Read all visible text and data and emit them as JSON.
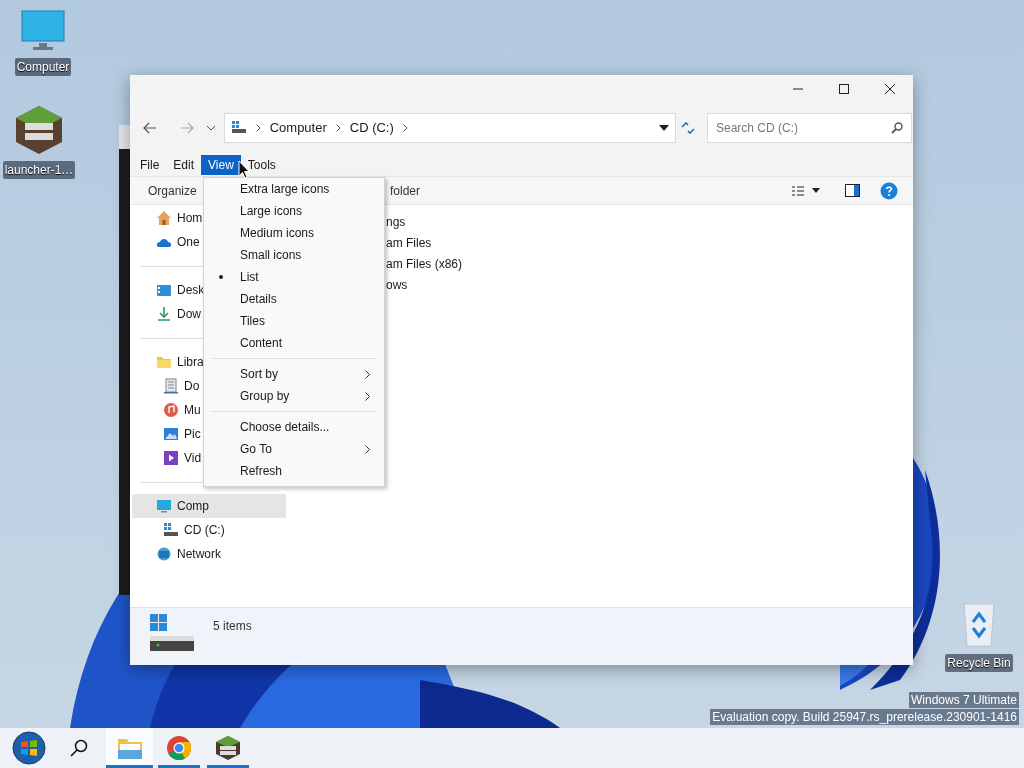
{
  "desktop_icons": [
    {
      "kind": "computer",
      "label": "Computer"
    },
    {
      "kind": "game",
      "label": "launcher-1…"
    },
    {
      "kind": "recycle",
      "label": "Recycle Bin"
    }
  ],
  "window": {
    "address_bar": {
      "path": [
        "Computer",
        "CD (C:)"
      ]
    },
    "search": {
      "placeholder": "Search CD (C:)"
    },
    "menu_bar": [
      {
        "label": "File",
        "selected": false
      },
      {
        "label": "Edit",
        "selected": false
      },
      {
        "label": "View",
        "selected": true
      },
      {
        "label": "Tools",
        "selected": false
      }
    ],
    "command_bar": {
      "organize": "Organize",
      "new_folder": "folder"
    },
    "nav_pane": [
      {
        "items": [
          {
            "kind": "home",
            "label": "Hom",
            "selected": false
          },
          {
            "kind": "cloud",
            "label": "One",
            "selected": false
          }
        ]
      },
      {
        "items": [
          {
            "kind": "desktop",
            "label": "Desk",
            "selected": false
          },
          {
            "kind": "download",
            "label": "Dow",
            "selected": false
          }
        ]
      },
      {
        "items": [
          {
            "kind": "folder",
            "label": "Libra",
            "selected": false,
            "children": [
              {
                "kind": "document",
                "label": "Do",
                "selected": false
              },
              {
                "kind": "music",
                "label": "Mu",
                "selected": false
              },
              {
                "kind": "picture",
                "label": "Pic",
                "selected": false
              },
              {
                "kind": "video",
                "label": "Vid",
                "selected": false
              }
            ]
          }
        ]
      },
      {
        "items": [
          {
            "kind": "computer",
            "label": "Comp",
            "selected": true,
            "children": [
              {
                "kind": "drive",
                "label": "CD (C:)",
                "selected": false
              }
            ]
          },
          {
            "kind": "network",
            "label": "Network",
            "selected": false
          }
        ]
      }
    ],
    "content_items": [
      "ngs",
      "am Files",
      "am Files (x86)",
      "ows"
    ],
    "status_bar": {
      "count": "5 items"
    },
    "view_menu": [
      {
        "kind": "item",
        "label": "Extra large icons",
        "checked": false,
        "submenu": false
      },
      {
        "kind": "item",
        "label": "Large icons",
        "checked": false,
        "submenu": false
      },
      {
        "kind": "item",
        "label": "Medium icons",
        "checked": false,
        "submenu": false
      },
      {
        "kind": "item",
        "label": "Small icons",
        "checked": false,
        "submenu": false
      },
      {
        "kind": "item",
        "label": "List",
        "checked": true,
        "submenu": false
      },
      {
        "kind": "item",
        "label": "Details",
        "checked": false,
        "submenu": false
      },
      {
        "kind": "item",
        "label": "Tiles",
        "checked": false,
        "submenu": false
      },
      {
        "kind": "item",
        "label": "Content",
        "checked": false,
        "submenu": false
      },
      {
        "kind": "separator"
      },
      {
        "kind": "item",
        "label": "Sort by",
        "checked": false,
        "submenu": true
      },
      {
        "kind": "item",
        "label": "Group by",
        "checked": false,
        "submenu": true
      },
      {
        "kind": "separator"
      },
      {
        "kind": "item",
        "label": "Choose details...",
        "checked": false,
        "submenu": false
      },
      {
        "kind": "item",
        "label": "Go To",
        "checked": false,
        "submenu": true
      },
      {
        "kind": "item",
        "label": "Refresh",
        "checked": false,
        "submenu": false
      }
    ]
  },
  "os_watermark": [
    "Windows 7 Ultimate",
    "Evaluation copy. Build 25947.rs_prerelease.230901-1416"
  ],
  "taskbar": [
    {
      "kind": "start"
    },
    {
      "kind": "search"
    },
    {
      "kind": "explorer",
      "running": true,
      "active": true
    },
    {
      "kind": "chrome",
      "running": true,
      "active": false
    },
    {
      "kind": "game",
      "running": true,
      "active": false
    }
  ]
}
